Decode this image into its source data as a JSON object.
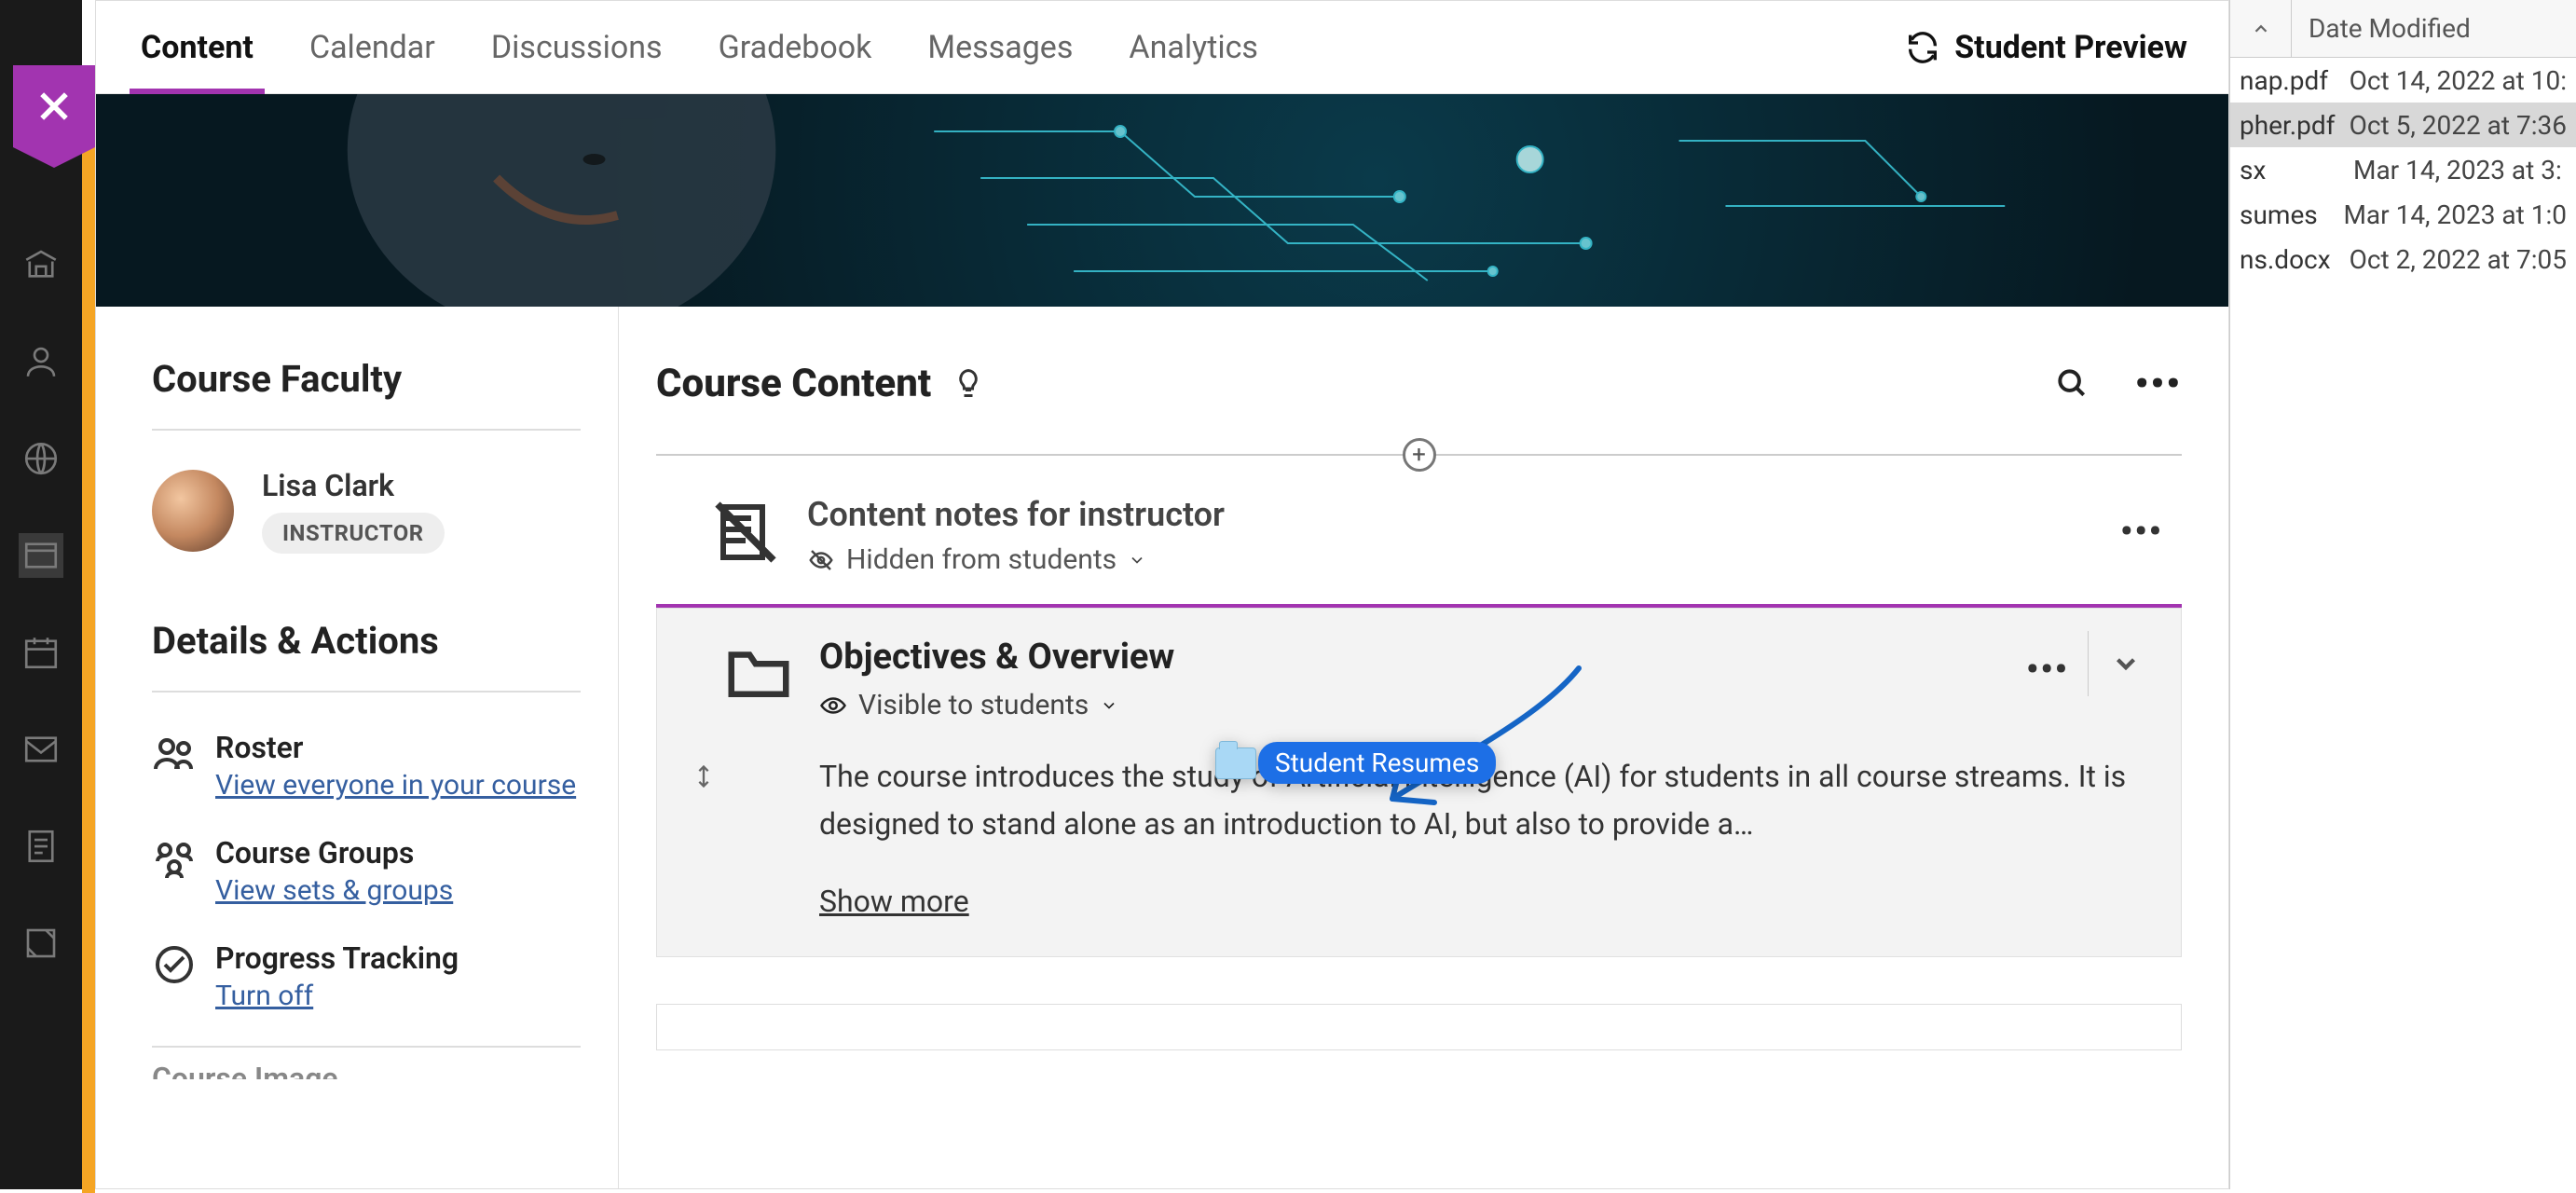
{
  "tabs": {
    "content": "Content",
    "calendar": "Calendar",
    "discussions": "Discussions",
    "gradebook": "Gradebook",
    "messages": "Messages",
    "analytics": "Analytics"
  },
  "student_preview": "Student Preview",
  "left_col": {
    "faculty_heading": "Course Faculty",
    "faculty_name": "Lisa Clark",
    "faculty_role": "INSTRUCTOR",
    "details_heading": "Details & Actions",
    "roster": {
      "title": "Roster",
      "link": "View everyone in your course"
    },
    "groups": {
      "title": "Course Groups",
      "link": "View sets & groups"
    },
    "progress": {
      "title": "Progress Tracking",
      "link": "Turn off"
    },
    "image_title": "Course Image"
  },
  "content": {
    "heading": "Course Content",
    "item_notes": {
      "title": "Content notes for instructor",
      "visibility": "Hidden from students"
    },
    "objectives": {
      "title": "Objectives & Overview",
      "visibility": "Visible to students",
      "description": "The course introduces the study of Artificial Intelligence (AI) for students in all course streams. It is designed to stand alone as an introduction to AI, but also to provide a…",
      "show_more": "Show more"
    }
  },
  "drag_label": "Student Resumes",
  "finder": {
    "header": "Date Modified",
    "rows": [
      {
        "name": "nap.pdf",
        "date": "Oct 14, 2022 at 10:"
      },
      {
        "name": "pher.pdf",
        "date": "Oct 5, 2022 at 7:36"
      },
      {
        "name": "sx",
        "date": "Mar 14, 2023 at 3:"
      },
      {
        "name": "sumes",
        "date": "Mar 14, 2023 at 1:0"
      },
      {
        "name": "ns.docx",
        "date": "Oct 2, 2022 at 7:05"
      }
    ]
  }
}
